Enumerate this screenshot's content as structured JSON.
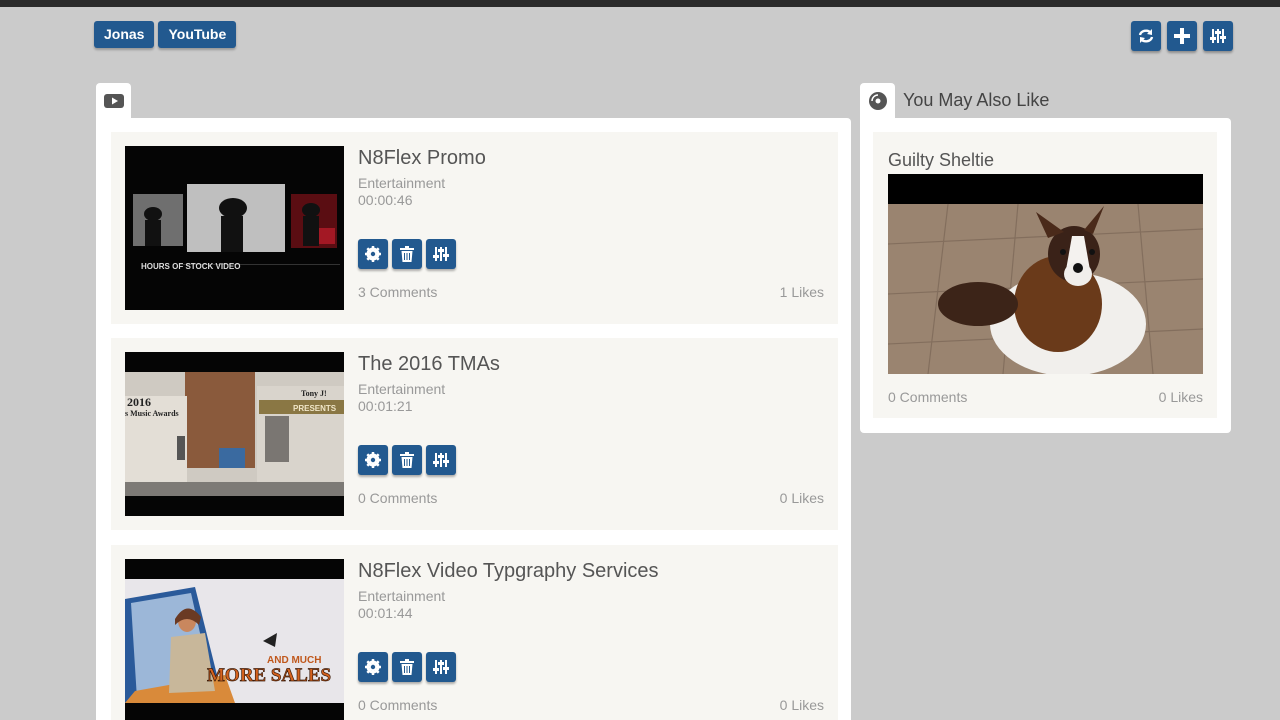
{
  "breadcrumbs": [
    "Jonas",
    "YouTube"
  ],
  "top_actions": {
    "refresh_icon": "refresh-icon",
    "add_icon": "plus-icon",
    "filter_icon": "sliders-icon"
  },
  "colors": {
    "accent": "#22598f",
    "page_bg": "#cbcbcb",
    "card_bg": "#f7f6f2"
  },
  "main_panel": {
    "tab_icon": "youtube-icon"
  },
  "videos": [
    {
      "title": "N8Flex Promo",
      "category": "Entertainment",
      "duration": "00:00:46",
      "comments": "3 Comments",
      "likes": "1 Likes",
      "thumb_text": "HOURS OF STOCK VIDEO"
    },
    {
      "title": "The 2016 TMAs",
      "category": "Entertainment",
      "duration": "00:01:21",
      "comments": "0 Comments",
      "likes": "0 Likes",
      "thumb_text": [
        "2016",
        "s Music Awards",
        "Tony J!",
        "PRESENTS"
      ]
    },
    {
      "title": "N8Flex Video Typgraphy Services",
      "category": "Entertainment",
      "duration": "00:01:44",
      "comments": "0 Comments",
      "likes": "0 Likes",
      "thumb_text": [
        "AND MUCH",
        "MORE SALES"
      ]
    }
  ],
  "sidebar": {
    "title": "You May Also Like",
    "tab_icon": "disc-icon",
    "items": [
      {
        "title": "Guilty Sheltie",
        "comments": "0 Comments",
        "likes": "0 Likes"
      }
    ]
  }
}
